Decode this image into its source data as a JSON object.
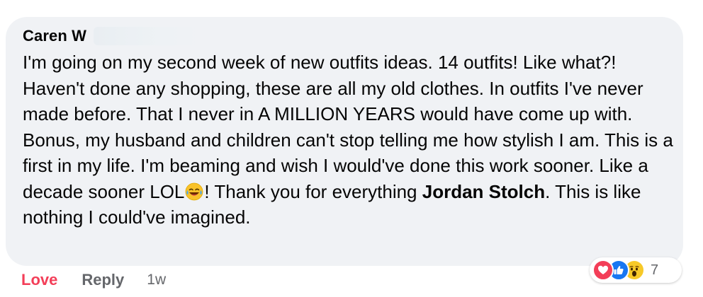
{
  "comment": {
    "author": "Caren W",
    "text_before_emoji": "I'm going on my second week of new outfits ideas. 14 outfits! Like what?! Haven't done any shopping, these are all my old clothes. In outfits I've never made before. That I never in A MILLION YEARS would have come up with. Bonus, my husband and children can't stop telling me how stylish I am. This is a first in my life. I'm beaming and wish I would've done this work sooner. Like a decade sooner LOL",
    "emoji": "laughing-crying-emoji",
    "text_after_emoji": "! Thank you for everything ",
    "mention": "Jordan Stolch",
    "text_end": ". This is like nothing I could've imagined."
  },
  "reactions": {
    "icons": [
      "love-icon",
      "like-icon",
      "wow-icon"
    ],
    "count": "7"
  },
  "actions": {
    "love_label": "Love",
    "reply_label": "Reply",
    "timestamp": "1w"
  },
  "colors": {
    "bubble_bg": "#f0f2f5",
    "text": "#050505",
    "secondary_text": "#65676b",
    "love_red": "#f33e58",
    "like_blue": "#1877f2",
    "wow_yellow": "#f7c928"
  }
}
